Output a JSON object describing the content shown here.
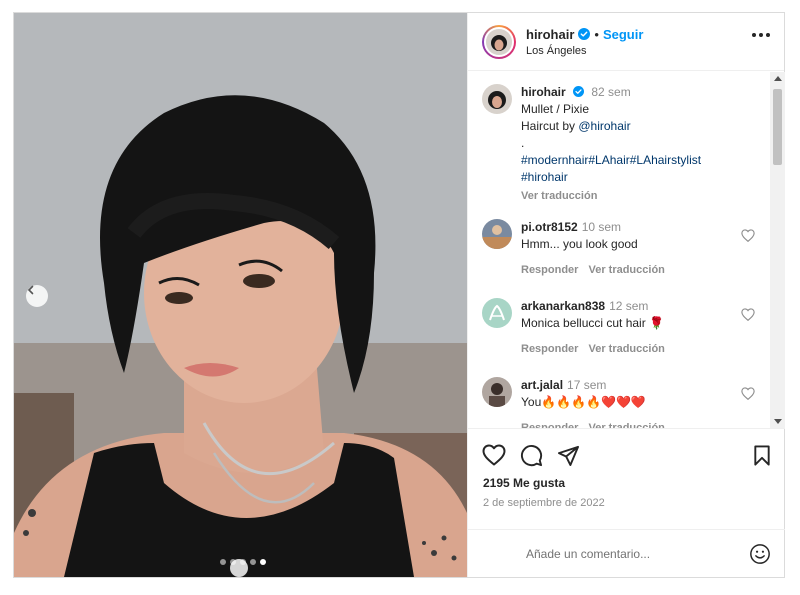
{
  "post": {
    "author": {
      "username": "hirohair",
      "verified": true,
      "follow_label": "Seguir",
      "separator": "•",
      "location": "Los Ángeles"
    },
    "carousel": {
      "slides": 5,
      "active_index": 4
    },
    "caption": {
      "username": "hirohair",
      "time": "82 sem",
      "line1": "Mullet / Pixie",
      "line2_prefix": "Haircut by ",
      "line2_mention": "@hirohair",
      "line3": ".",
      "hashtags_line1": "#modernhair#LAhair#LAhairstylist",
      "hashtags_line2": "#hirohair",
      "translate_label": "Ver traducción"
    },
    "comments": [
      {
        "username": "pi.otr8152",
        "time": "10 sem",
        "text": "Hmm... you look good",
        "reply_label": "Responder",
        "translate_label": "Ver traducción"
      },
      {
        "username": "arkanarkan838",
        "time": "12 sem",
        "text": "Monica bellucci cut hair 🌹",
        "reply_label": "Responder",
        "translate_label": "Ver traducción"
      },
      {
        "username": "art.jalal",
        "time": "17 sem",
        "text": "You🔥🔥🔥🔥❤️❤️❤️",
        "reply_label": "Responder",
        "translate_label": "Ver traducción"
      }
    ],
    "likes": "2195 Me gusta",
    "date": "2 de septiembre de 2022",
    "add_comment": {
      "placeholder": "Añade un comentario..."
    }
  },
  "colors": {
    "accent": "#0095f6",
    "verified": "#0095f6",
    "text": "#262626",
    "muted": "#8e8e8e",
    "border": "#dbdbdb"
  },
  "icons": [
    "verified-icon",
    "more-icon",
    "heart-icon",
    "comment-icon",
    "share-icon",
    "bookmark-icon",
    "emoji-icon",
    "chevron-left-icon"
  ]
}
